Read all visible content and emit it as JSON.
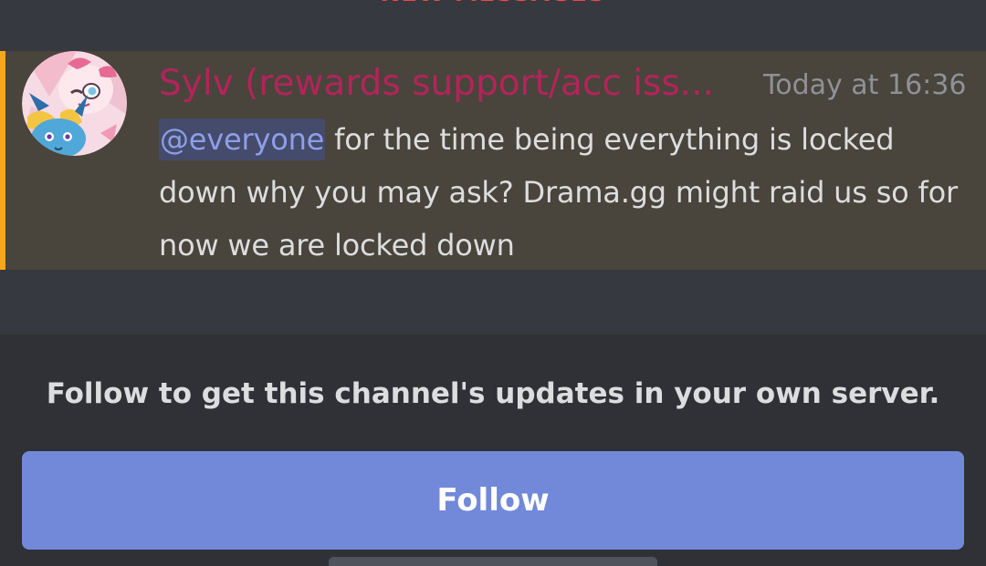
{
  "new_messages": {
    "label": "NEW MESSAGES"
  },
  "message": {
    "author": "Sylv (rewards support/acc iss...",
    "author_color": "#b3245a",
    "timestamp": "Today at 16:36",
    "mention": "@everyone",
    "text": " for the time being everything is locked down why you may ask? Drama.gg might raid us so for now we are locked down",
    "highlight_color": "#faa61a"
  },
  "follow": {
    "prompt": "Follow to get this channel's updates in your own server.",
    "button_label": "Follow",
    "button_color": "#7289da"
  }
}
